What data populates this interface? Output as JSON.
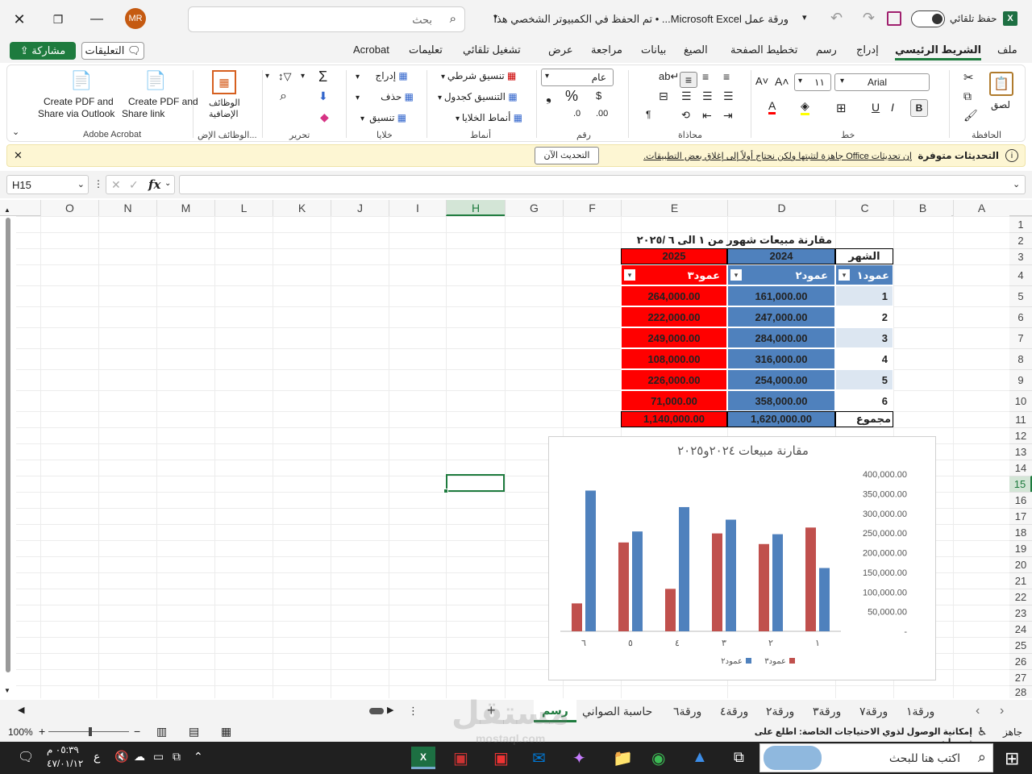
{
  "titlebar": {
    "autosave_label": "حفظ تلقائي",
    "doc_title": "ورقة عمل Microsoft Excel...  •  تم الحفظ في الكمبيوتر الشخصي هذا",
    "search_placeholder": "بحث",
    "avatar_initials": "MR"
  },
  "tabs": [
    "ملف",
    "الشريط الرئيسي",
    "إدراج",
    "رسم",
    "تخطيط الصفحة",
    "الصيغ",
    "بيانات",
    "مراجعة",
    "عرض",
    "تشغيل تلقائي",
    "تعليمات",
    "Acrobat"
  ],
  "active_tab": "الشريط الرئيسي",
  "comments_label": "التعليقات",
  "share_label": "مشاركة",
  "ribbon": {
    "clipboard": {
      "paste": "لصق",
      "group": "الحافظة"
    },
    "font": {
      "name": "Arial",
      "size": "١١",
      "group": "خط"
    },
    "alignment": {
      "group": "محاذاة"
    },
    "number": {
      "format": "عام",
      "group": "رقم"
    },
    "styles": {
      "cond": "تنسيق شرطي",
      "table": "التنسيق كجدول",
      "cell": "أنماط الخلايا",
      "group": "أنماط"
    },
    "cells": {
      "insert": "إدراج",
      "delete": "حذف",
      "format": "تنسيق",
      "group": "خلايا"
    },
    "editing": {
      "group": "تحرير"
    },
    "addins": {
      "label1": "الوظائف",
      "label2": "الإضافية",
      "group": "الوظائف الإض..."
    },
    "acrobat": {
      "btn1a": "Create PDF and",
      "btn1b": "Share link",
      "btn2a": "Create PDF and",
      "btn2b": "Share via Outlook",
      "group": "Adobe Acrobat"
    }
  },
  "notice": {
    "title": "التحديثات متوفرة",
    "message": "إن تحديثات Office جاهزة لتثبتها ولكن نحتاج أولاً إلى إغلاق بعض التطبيقات.",
    "button": "التحديث الآن"
  },
  "formula_bar": {
    "name_box": "H15",
    "fx": "fx",
    "value": ""
  },
  "columns": [
    "A",
    "B",
    "C",
    "D",
    "E",
    "F",
    "G",
    "H",
    "I",
    "J",
    "K",
    "L",
    "M",
    "N",
    "O"
  ],
  "rows": [
    "1",
    "2",
    "3",
    "4",
    "5",
    "6",
    "7",
    "8",
    "9",
    "10",
    "11",
    "12",
    "13",
    "14",
    "15",
    "16",
    "17",
    "18",
    "19",
    "20",
    "21",
    "22",
    "23",
    "24",
    "25",
    "26",
    "27",
    "28"
  ],
  "table": {
    "title": "مقارنة مبيعات شهور من ١ الى ٦ /٢٠٢٥",
    "month_header": "الشهر",
    "year1": "2024",
    "year2": "2025",
    "col1": "عمود١",
    "col2": "عمود٢",
    "col3": "عمود٣",
    "rows": [
      {
        "m": "1",
        "a": "161,000.00",
        "b": "264,000.00"
      },
      {
        "m": "2",
        "a": "247,000.00",
        "b": "222,000.00"
      },
      {
        "m": "3",
        "a": "284,000.00",
        "b": "249,000.00"
      },
      {
        "m": "4",
        "a": "316,000.00",
        "b": "108,000.00"
      },
      {
        "m": "5",
        "a": "254,000.00",
        "b": "226,000.00"
      },
      {
        "m": "6",
        "a": "358,000.00",
        "b": "71,000.00"
      }
    ],
    "total_label": "مجموع",
    "total_a": "1,620,000.00",
    "total_b": "1,140,000.00",
    "colors": {
      "blue": "#4f81bd",
      "red": "#ff0000",
      "light": "#dce6f1"
    }
  },
  "chart_data": {
    "type": "bar",
    "title": "مقارنة مبيعات ٢٠٢٤و٢٠٢٥",
    "categories": [
      "١",
      "٢",
      "٣",
      "٤",
      "٥",
      "٦"
    ],
    "series": [
      {
        "name": "عمود٢",
        "values": [
          161000,
          247000,
          284000,
          316000,
          254000,
          358000
        ],
        "color": "#4f81bd"
      },
      {
        "name": "عمود٣",
        "values": [
          264000,
          222000,
          249000,
          108000,
          226000,
          71000
        ],
        "color": "#c0504d"
      }
    ],
    "y_ticks": [
      "-",
      "50,000.00",
      "100,000.00",
      "150,000.00",
      "200,000.00",
      "250,000.00",
      "300,000.00",
      "350,000.00",
      "400,000.00"
    ],
    "ylim": [
      0,
      400000
    ],
    "legend": "bottom",
    "axis_side": "right"
  },
  "sheets": [
    "ورقة١",
    "ورقة٧",
    "ورقة٣",
    "ورقة٢",
    "ورقة٤",
    "ورقة٦",
    "حاسبة الصواني",
    "رسم"
  ],
  "active_sheet": "رسم",
  "status": {
    "ready": "جاهز",
    "accessibility": "إمكانية الوصول لذوي الاحتياجات الخاصة: اطلع على توصيات",
    "zoom": "100%"
  },
  "taskbar": {
    "search_placeholder": "اكتب هنا للبحث",
    "time": "٠٥:٣٩ م",
    "date": "٤٧/٠١/١٢",
    "lang": "ع"
  },
  "watermark": "mostaql.com"
}
